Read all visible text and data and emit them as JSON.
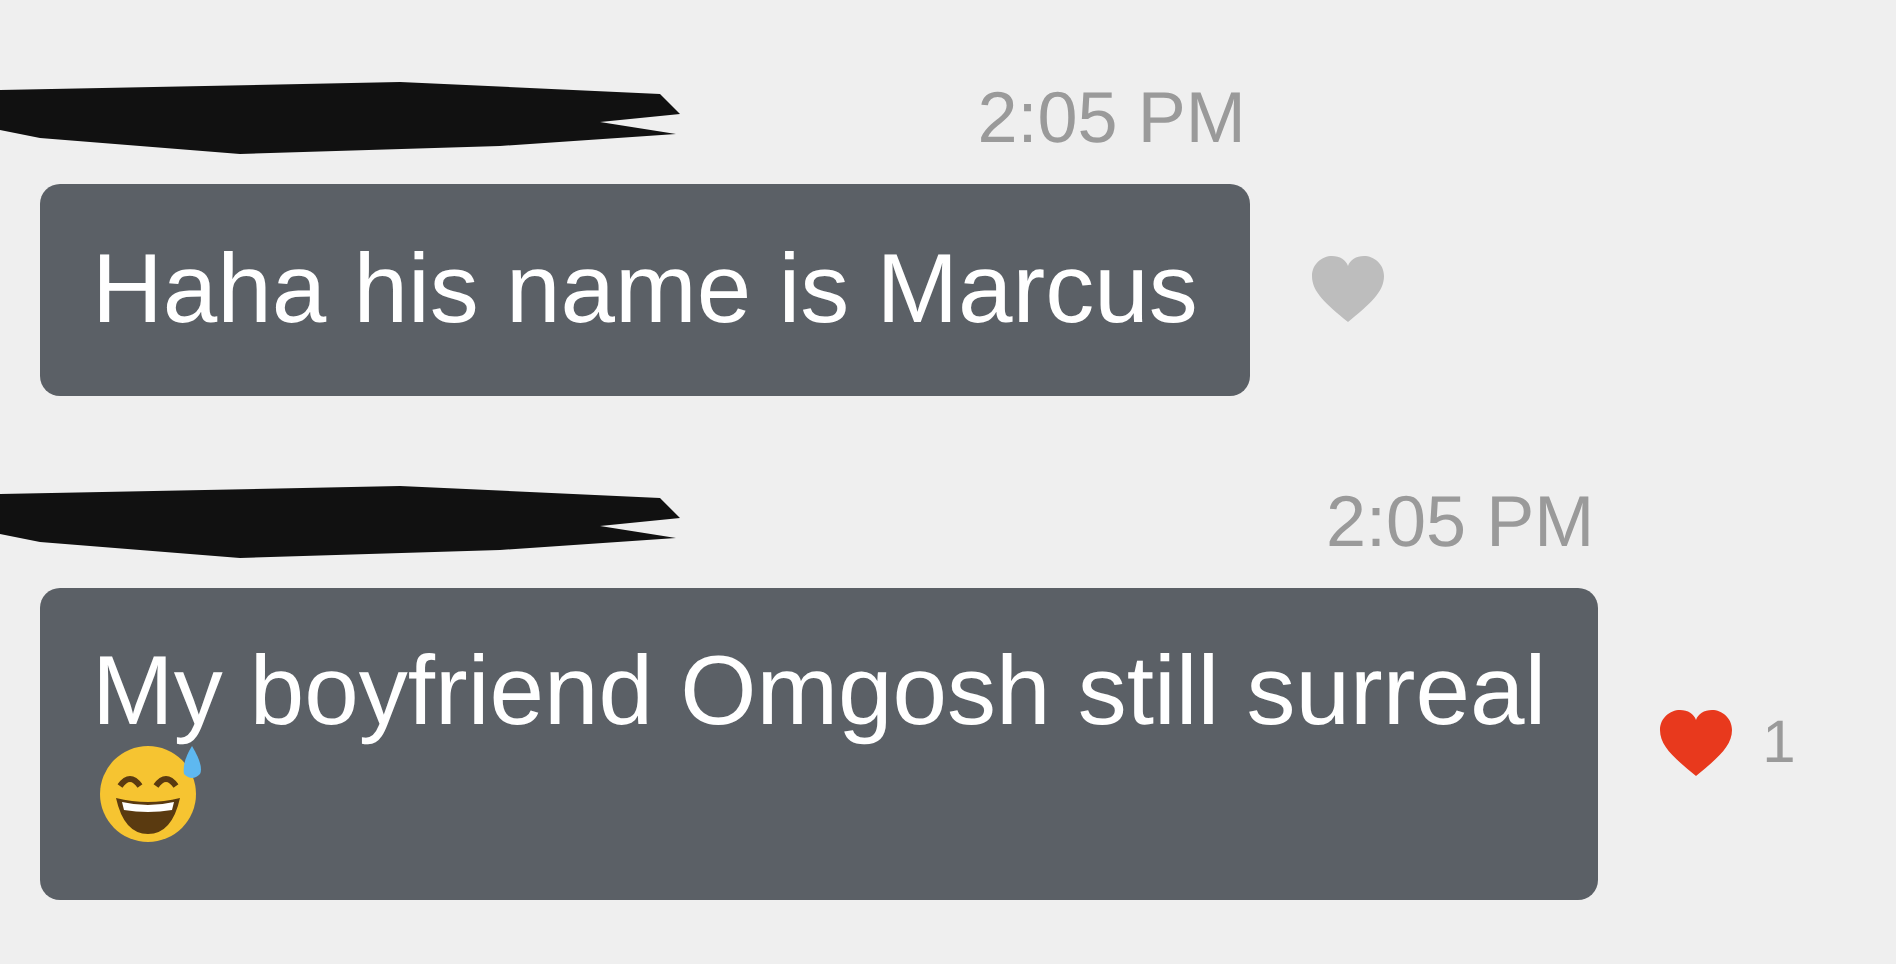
{
  "messages": [
    {
      "sender_redacted": true,
      "time": "2:05 PM",
      "text": "Haha his name is Marcus",
      "trailing_emoji": false,
      "liked": false
    },
    {
      "sender_redacted": true,
      "time": "2:05 PM",
      "text": "My boyfriend Omgosh still surreal",
      "trailing_emoji": true,
      "liked": true,
      "like_count": "1"
    }
  ]
}
